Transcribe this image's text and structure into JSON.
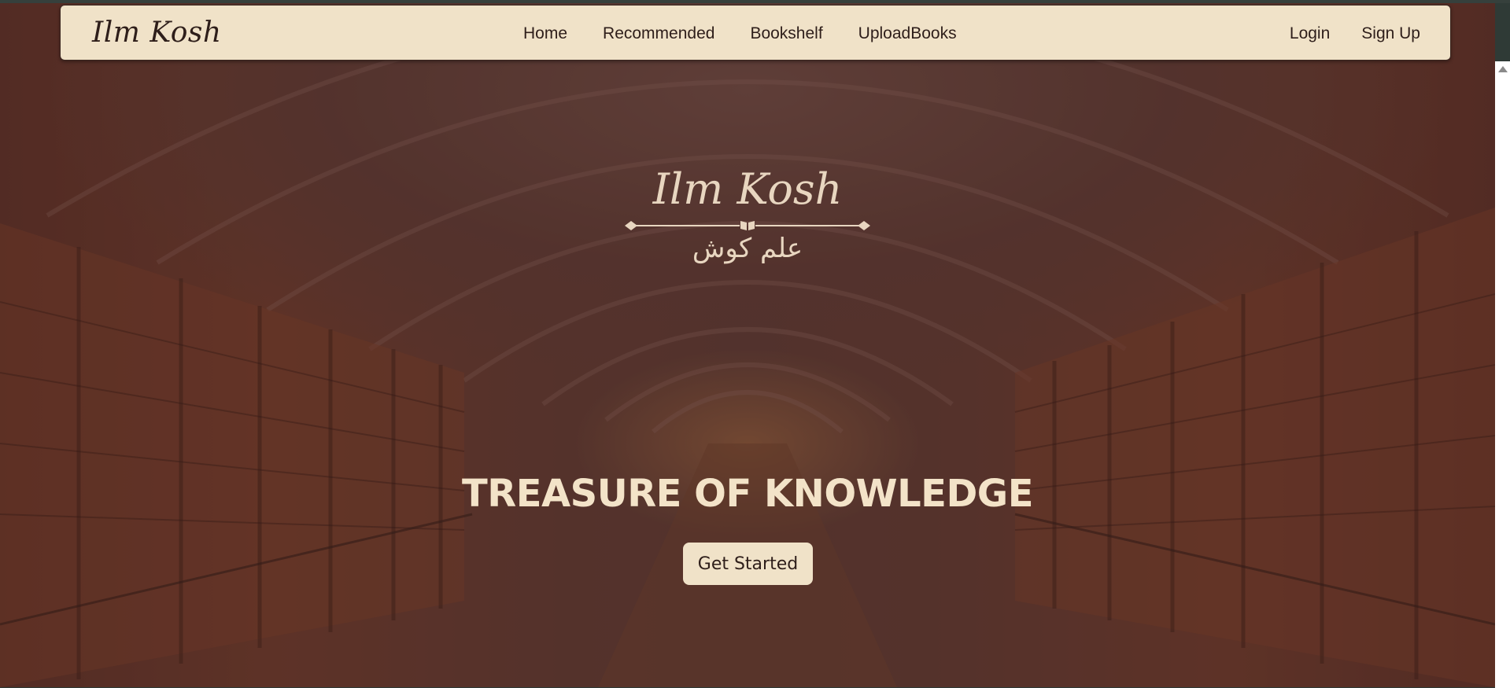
{
  "navbar": {
    "brand": "Ilm Kosh",
    "links": [
      "Home",
      "Recommended",
      "Bookshelf",
      "UploadBooks"
    ],
    "auth": [
      "Login",
      "Sign Up"
    ]
  },
  "hero": {
    "logo_en": "Ilm Kosh",
    "logo_ar": "علم کوش",
    "title": "TREASURE OF KNOWLEDGE",
    "cta_label": "Get Started"
  },
  "colors": {
    "navbar_bg": "#f0e2c8",
    "text_dark": "#2e1e1a",
    "hero_text": "#f3e3c8",
    "overlay": "#5b3a33"
  },
  "icons": [
    "book-icon",
    "scroll-up-arrow-icon"
  ]
}
